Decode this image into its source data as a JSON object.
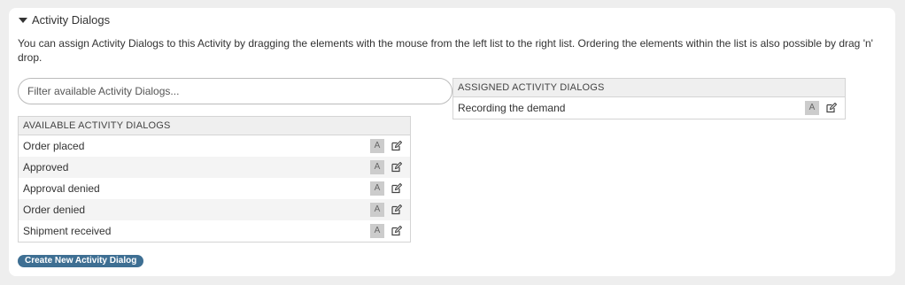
{
  "section": {
    "title": "Activity Dialogs",
    "description": "You can assign Activity Dialogs to this Activity by dragging the elements with the mouse from the left list to the right list. Ordering the elements within the list is also possible by drag 'n' drop."
  },
  "filter": {
    "placeholder": "Filter available Activity Dialogs..."
  },
  "available": {
    "header": "AVAILABLE ACTIVITY DIALOGS",
    "items": [
      {
        "label": "Order placed",
        "badge": "A"
      },
      {
        "label": "Approved",
        "badge": "A"
      },
      {
        "label": "Approval denied",
        "badge": "A"
      },
      {
        "label": "Order denied",
        "badge": "A"
      },
      {
        "label": "Shipment received",
        "badge": "A"
      }
    ]
  },
  "assigned": {
    "header": "ASSIGNED ACTIVITY DIALOGS",
    "items": [
      {
        "label": "Recording the demand",
        "badge": "A"
      }
    ]
  },
  "actions": {
    "create_label": "Create New Activity Dialog"
  },
  "icons": {
    "collapse": "caret-down-icon",
    "edit": "edit-icon"
  },
  "colors": {
    "button": "#3e6f93",
    "panel_bg": "#ffffff",
    "page_bg": "#eeeeee"
  }
}
